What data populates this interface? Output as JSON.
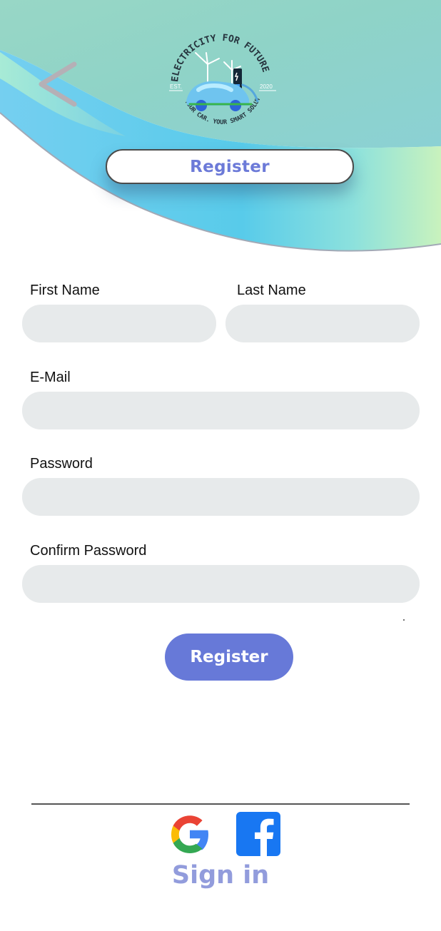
{
  "header": {
    "title": "Register",
    "logo": {
      "top_text": "ELECTRICITY FOR FUTURE",
      "bottom_text": "YOUR CAR. YOUR SMART SOLUTION.",
      "est_label": "EST.",
      "year": "2020"
    },
    "icons": {
      "back": "back-chevron-icon"
    }
  },
  "form": {
    "first_name": {
      "label": "First Name",
      "value": "",
      "placeholder": ""
    },
    "last_name": {
      "label": "Last Name",
      "value": "",
      "placeholder": ""
    },
    "email": {
      "label": "E-Mail",
      "value": "",
      "placeholder": ""
    },
    "password": {
      "label": "Password",
      "value": "",
      "placeholder": ""
    },
    "confirm_password": {
      "label": "Confirm Password",
      "value": "",
      "placeholder": ""
    }
  },
  "actions": {
    "register_label": "Register",
    "sign_in_label": "Sign in"
  },
  "social": {
    "google_icon": "google-icon",
    "facebook_icon": "facebook-icon"
  },
  "colors": {
    "accent": "#6779d8",
    "sign_in": "#929cdc",
    "input_bg": "#e7eaeb",
    "header_teal": "#8fd6c4",
    "header_blue": "#5ccfe9"
  }
}
